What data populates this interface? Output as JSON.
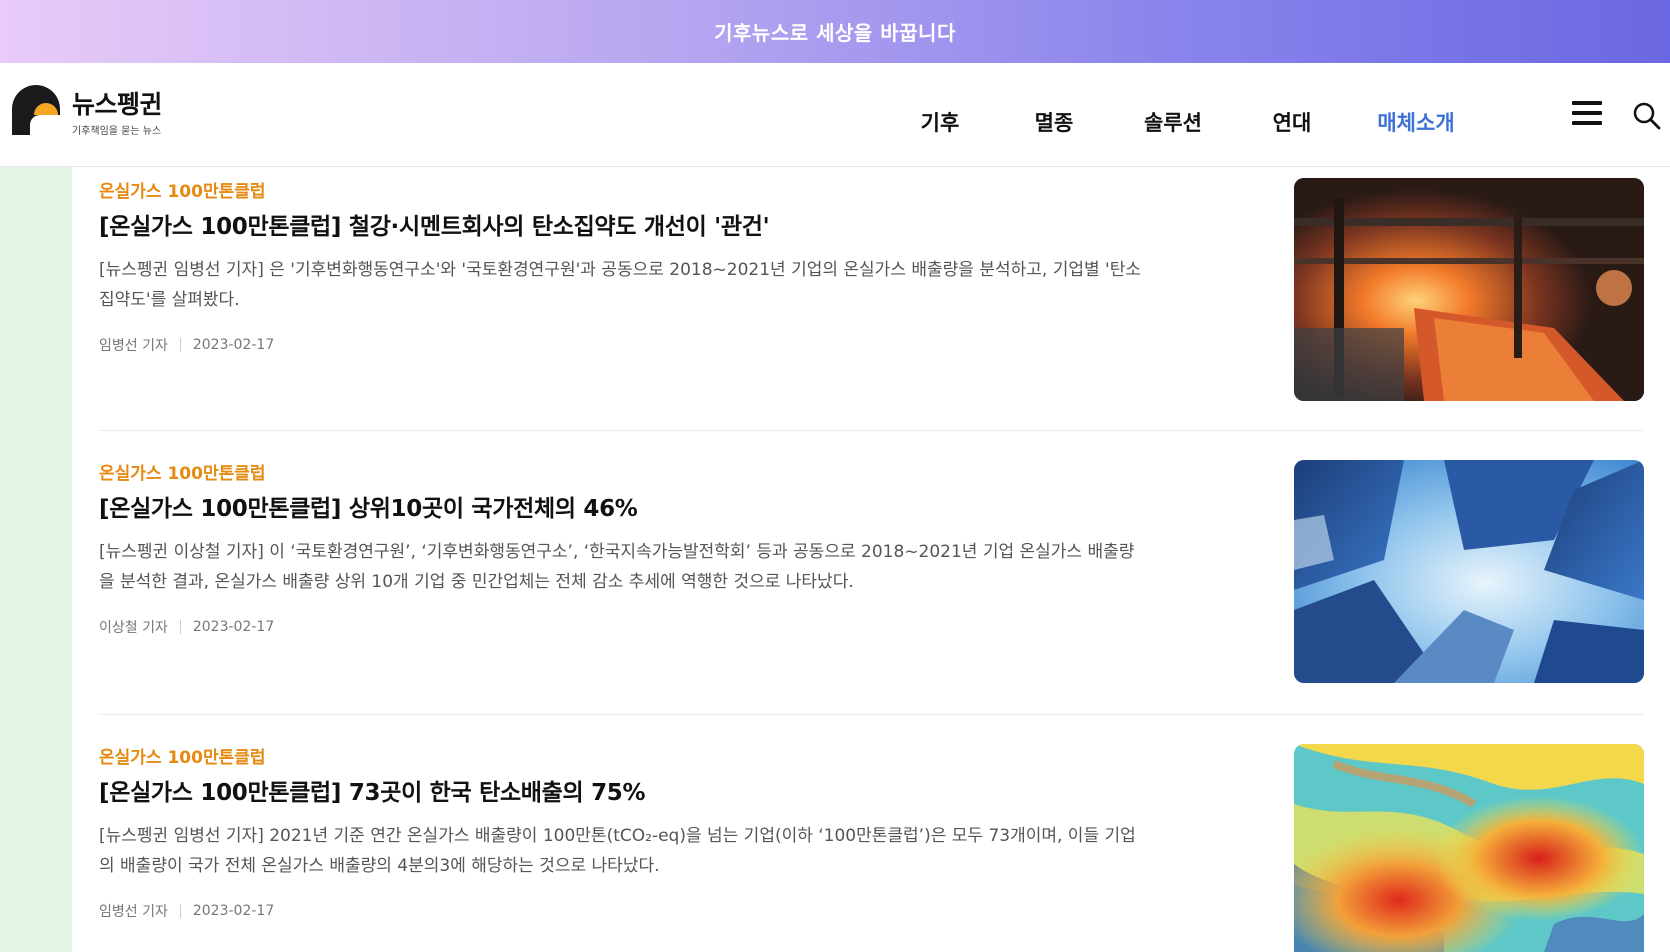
{
  "banner": {
    "text": "기후뉴스로 세상을 바꿉니다"
  },
  "logo": {
    "name": "뉴스펭귄",
    "tagline": "기후책임을 묻는 뉴스"
  },
  "nav": {
    "items": [
      {
        "label": "기후"
      },
      {
        "label": "멸종"
      },
      {
        "label": "솔루션"
      },
      {
        "label": "연대"
      },
      {
        "label": "매체소개",
        "active": true
      }
    ]
  },
  "icons": {
    "menu": "hamburger-menu-icon",
    "search": "search-icon"
  },
  "colors": {
    "accent_nav": "#3d73d6",
    "category": "#e68a12",
    "sidebar": "#e2f4e6",
    "banner_start": "#e8cbf8",
    "banner_end": "#6a67e2"
  },
  "articles": [
    {
      "category": "온실가스 100만톤클럽",
      "title": "[온실가스 100만톤클럽] 철강·시멘트회사의 탄소집약도 개선이 '관건'",
      "summary": "[뉴스펭귄 임병선 기자] 은 '기후변화행동연구소'와 '국토환경연구원'과 공동으로 2018~2021년 기업의 온실가스 배출량을 분석하고, 기업별 '탄소집약도'를 살펴봤다.",
      "author": "임병선 기자",
      "date": "2023-02-17",
      "image": "steel-mill-photo"
    },
    {
      "category": "온실가스 100만톤클럽",
      "title": "[온실가스 100만톤클럽] 상위10곳이 국가전체의 46%",
      "summary": "[뉴스펭귄 이상철 기자] 이 ‘국토환경연구원’, ‘기후변화행동연구소’, ‘한국지속가능발전학회’ 등과 공동으로 2018~2021년 기업 온실가스 배출량을 분석한 결과, 온실가스 배출량 상위 10개 기업 중 민간업체는 전체 감소 추세에 역행한 것으로 나타났다.",
      "author": "이상철 기자",
      "date": "2023-02-17",
      "image": "skyscrapers-photo"
    },
    {
      "category": "온실가스 100만톤클럽",
      "title": "[온실가스 100만톤클럽] 73곳이 한국 탄소배출의 75%",
      "summary": "[뉴스펭귄 임병선 기자] 2021년 기준 연간 온실가스 배출량이 100만톤(tCO₂-eq)을 넘는 기업(이하 ‘100만톤클럽’)은 모두 73개이며, 이들 기업의 배출량이 국가 전체 온실가스 배출량의 4분의3에 해당하는 것으로 나타났다.",
      "author": "임병선 기자",
      "date": "2023-02-17",
      "image": "emissions-heatmap-photo"
    }
  ]
}
